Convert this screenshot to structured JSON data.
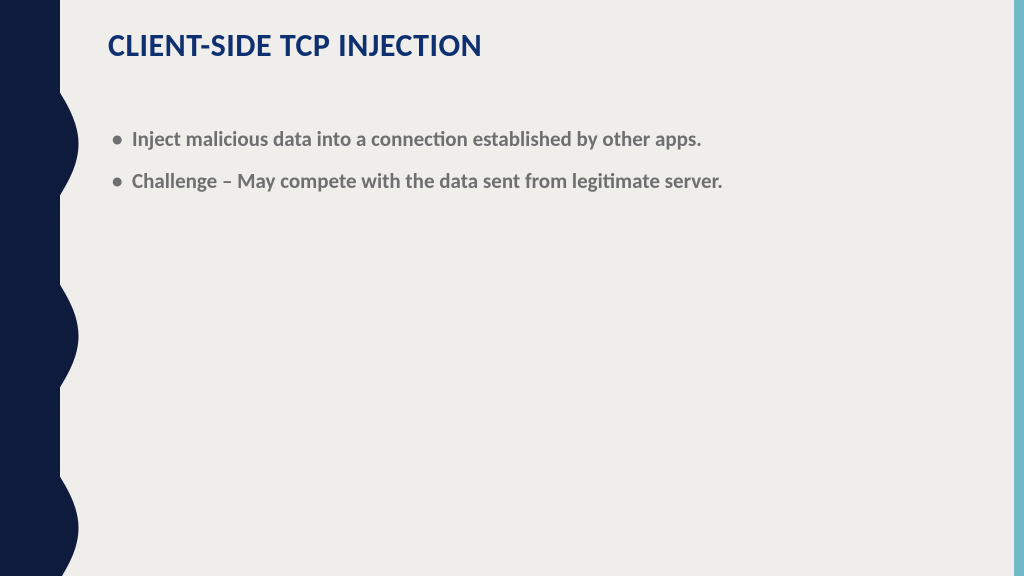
{
  "slide": {
    "title": "CLIENT-SIDE TCP INJECTION",
    "bullets": [
      "Inject malicious data into a connection established by other apps.",
      "Challenge – May compete with the data sent from legitimate server."
    ],
    "colors": {
      "band": "#0f1b3c",
      "background": "#efeeea",
      "accent": "#6fb9c8",
      "title": "#0f3070",
      "body": "#6d6f71"
    }
  }
}
